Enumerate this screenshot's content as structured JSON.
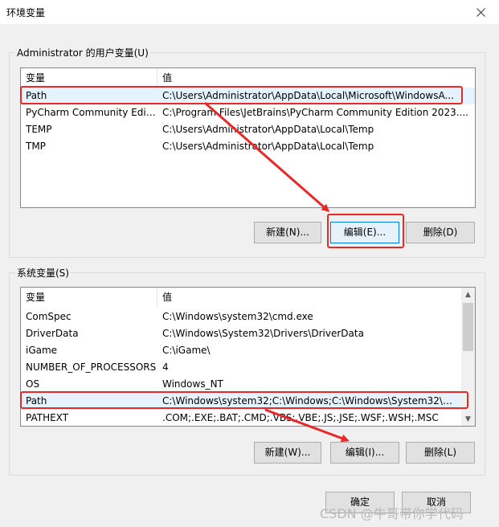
{
  "window": {
    "title": "环境变量",
    "close_icon": "close-icon"
  },
  "user_group": {
    "label": "Administrator 的用户变量(U)",
    "columns": [
      "变量",
      "值"
    ],
    "rows": [
      {
        "name": "Path",
        "value": "C:\\Users\\Administrator\\AppData\\Local\\Microsoft\\WindowsA..."
      },
      {
        "name": "PyCharm Community Editi...",
        "value": "C:\\Program Files\\JetBrains\\PyCharm Community Edition 2023...."
      },
      {
        "name": "TEMP",
        "value": "C:\\Users\\Administrator\\AppData\\Local\\Temp"
      },
      {
        "name": "TMP",
        "value": "C:\\Users\\Administrator\\AppData\\Local\\Temp"
      }
    ],
    "selected_row": "Path",
    "buttons": {
      "new": "新建(N)...",
      "edit": "编辑(E)...",
      "delete": "删除(D)"
    }
  },
  "system_group": {
    "label": "系统变量(S)",
    "columns": [
      "变量",
      "值"
    ],
    "rows": [
      {
        "name": "ComSpec",
        "value": "C:\\Windows\\system32\\cmd.exe"
      },
      {
        "name": "DriverData",
        "value": "C:\\Windows\\System32\\Drivers\\DriverData"
      },
      {
        "name": "iGame",
        "value": "C:\\iGame\\"
      },
      {
        "name": "NUMBER_OF_PROCESSORS",
        "value": "4"
      },
      {
        "name": "OS",
        "value": "Windows_NT"
      },
      {
        "name": "Path",
        "value": "C:\\Windows\\system32;C:\\Windows;C:\\Windows\\System32\\Wb..."
      },
      {
        "name": "PATHEXT",
        "value": ".COM;.EXE;.BAT;.CMD;.VBS;.VBE;.JS;.JSE;.WSF;.WSH;.MSC"
      }
    ],
    "selected_row": "Path",
    "buttons": {
      "new": "新建(W)...",
      "edit": "编辑(I)...",
      "delete": "删除(L)"
    }
  },
  "footer": {
    "ok": "确定",
    "cancel": "取消"
  },
  "watermark": "CSDN @牛哥带你学代码",
  "colors": {
    "highlight": "#e8292a",
    "selection": "#e5f3ff",
    "window_bg": "#f0f0f0"
  }
}
